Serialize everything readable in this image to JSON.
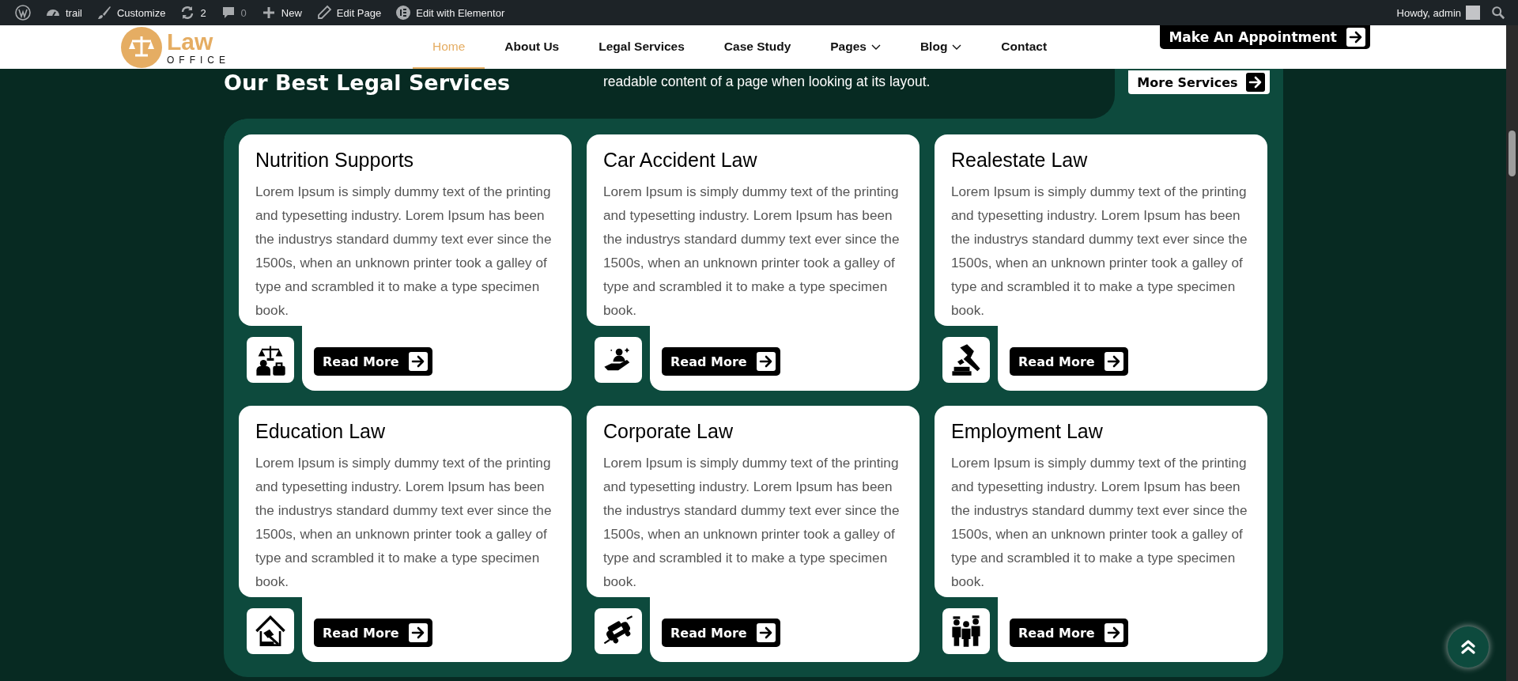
{
  "admin_bar": {
    "items": [
      {
        "kind": "logo"
      },
      {
        "kind": "site",
        "label": "trail"
      },
      {
        "kind": "customize",
        "label": "Customize"
      },
      {
        "kind": "updates",
        "label": "2"
      },
      {
        "kind": "comments",
        "label": "0"
      },
      {
        "kind": "new",
        "label": "New"
      },
      {
        "kind": "edit",
        "label": "Edit Page"
      },
      {
        "kind": "elementor",
        "label": "Edit with Elementor"
      }
    ],
    "greeting": "Howdy, admin"
  },
  "header": {
    "logo": {
      "word": "Law",
      "tagline": "OFFICE"
    },
    "nav": [
      {
        "label": "Home",
        "selected": true,
        "dropdown": false
      },
      {
        "label": "About Us",
        "selected": false,
        "dropdown": false
      },
      {
        "label": "Legal Services",
        "selected": false,
        "dropdown": false
      },
      {
        "label": "Case Study",
        "selected": false,
        "dropdown": false
      },
      {
        "label": "Pages",
        "selected": false,
        "dropdown": true
      },
      {
        "label": "Blog",
        "selected": false,
        "dropdown": true
      },
      {
        "label": "Contact",
        "selected": false,
        "dropdown": false
      }
    ],
    "cta": "Make An Appointment"
  },
  "section": {
    "title": "Our Best Legal Services",
    "description": "readable content of a page when looking at its layout.",
    "more_button": "More Services"
  },
  "services": [
    {
      "title": "Nutrition Supports",
      "text": "Lorem Ipsum is simply dummy text of the printing and typesetting industry. Lorem Ipsum has been the industrys standard dummy text ever since the 1500s, when an unknown printer took a galley of type and scrambled it to make a type specimen book.",
      "button": "Read More"
    },
    {
      "title": "Car Accident Law",
      "text": "Lorem Ipsum is simply dummy text of the printing and typesetting industry. Lorem Ipsum has been the industrys standard dummy text ever since the 1500s, when an unknown printer took a galley of type and scrambled it to make a type specimen book.",
      "button": "Read More"
    },
    {
      "title": "Realestate Law",
      "text": "Lorem Ipsum is simply dummy text of the printing and typesetting industry. Lorem Ipsum has been the industrys standard dummy text ever since the 1500s, when an unknown printer took a galley of type and scrambled it to make a type specimen book.",
      "button": "Read More"
    },
    {
      "title": "Education Law",
      "text": "Lorem Ipsum is simply dummy text of the printing and typesetting industry. Lorem Ipsum has been the industrys standard dummy text ever since the 1500s, when an unknown printer took a galley of type and scrambled it to make a type specimen book.",
      "button": "Read More"
    },
    {
      "title": "Corporate Law",
      "text": "Lorem Ipsum is simply dummy text of the printing and typesetting industry. Lorem Ipsum has been the industrys standard dummy text ever since the 1500s, when an unknown printer took a galley of type and scrambled it to make a type specimen book.",
      "button": "Read More"
    },
    {
      "title": "Employment Law",
      "text": "Lorem Ipsum is simply dummy text of the printing and typesetting industry. Lorem Ipsum has been the industrys standard dummy text ever since the 1500s, when an unknown printer took a galley of type and scrambled it to make a type specimen book.",
      "button": "Read More"
    }
  ]
}
